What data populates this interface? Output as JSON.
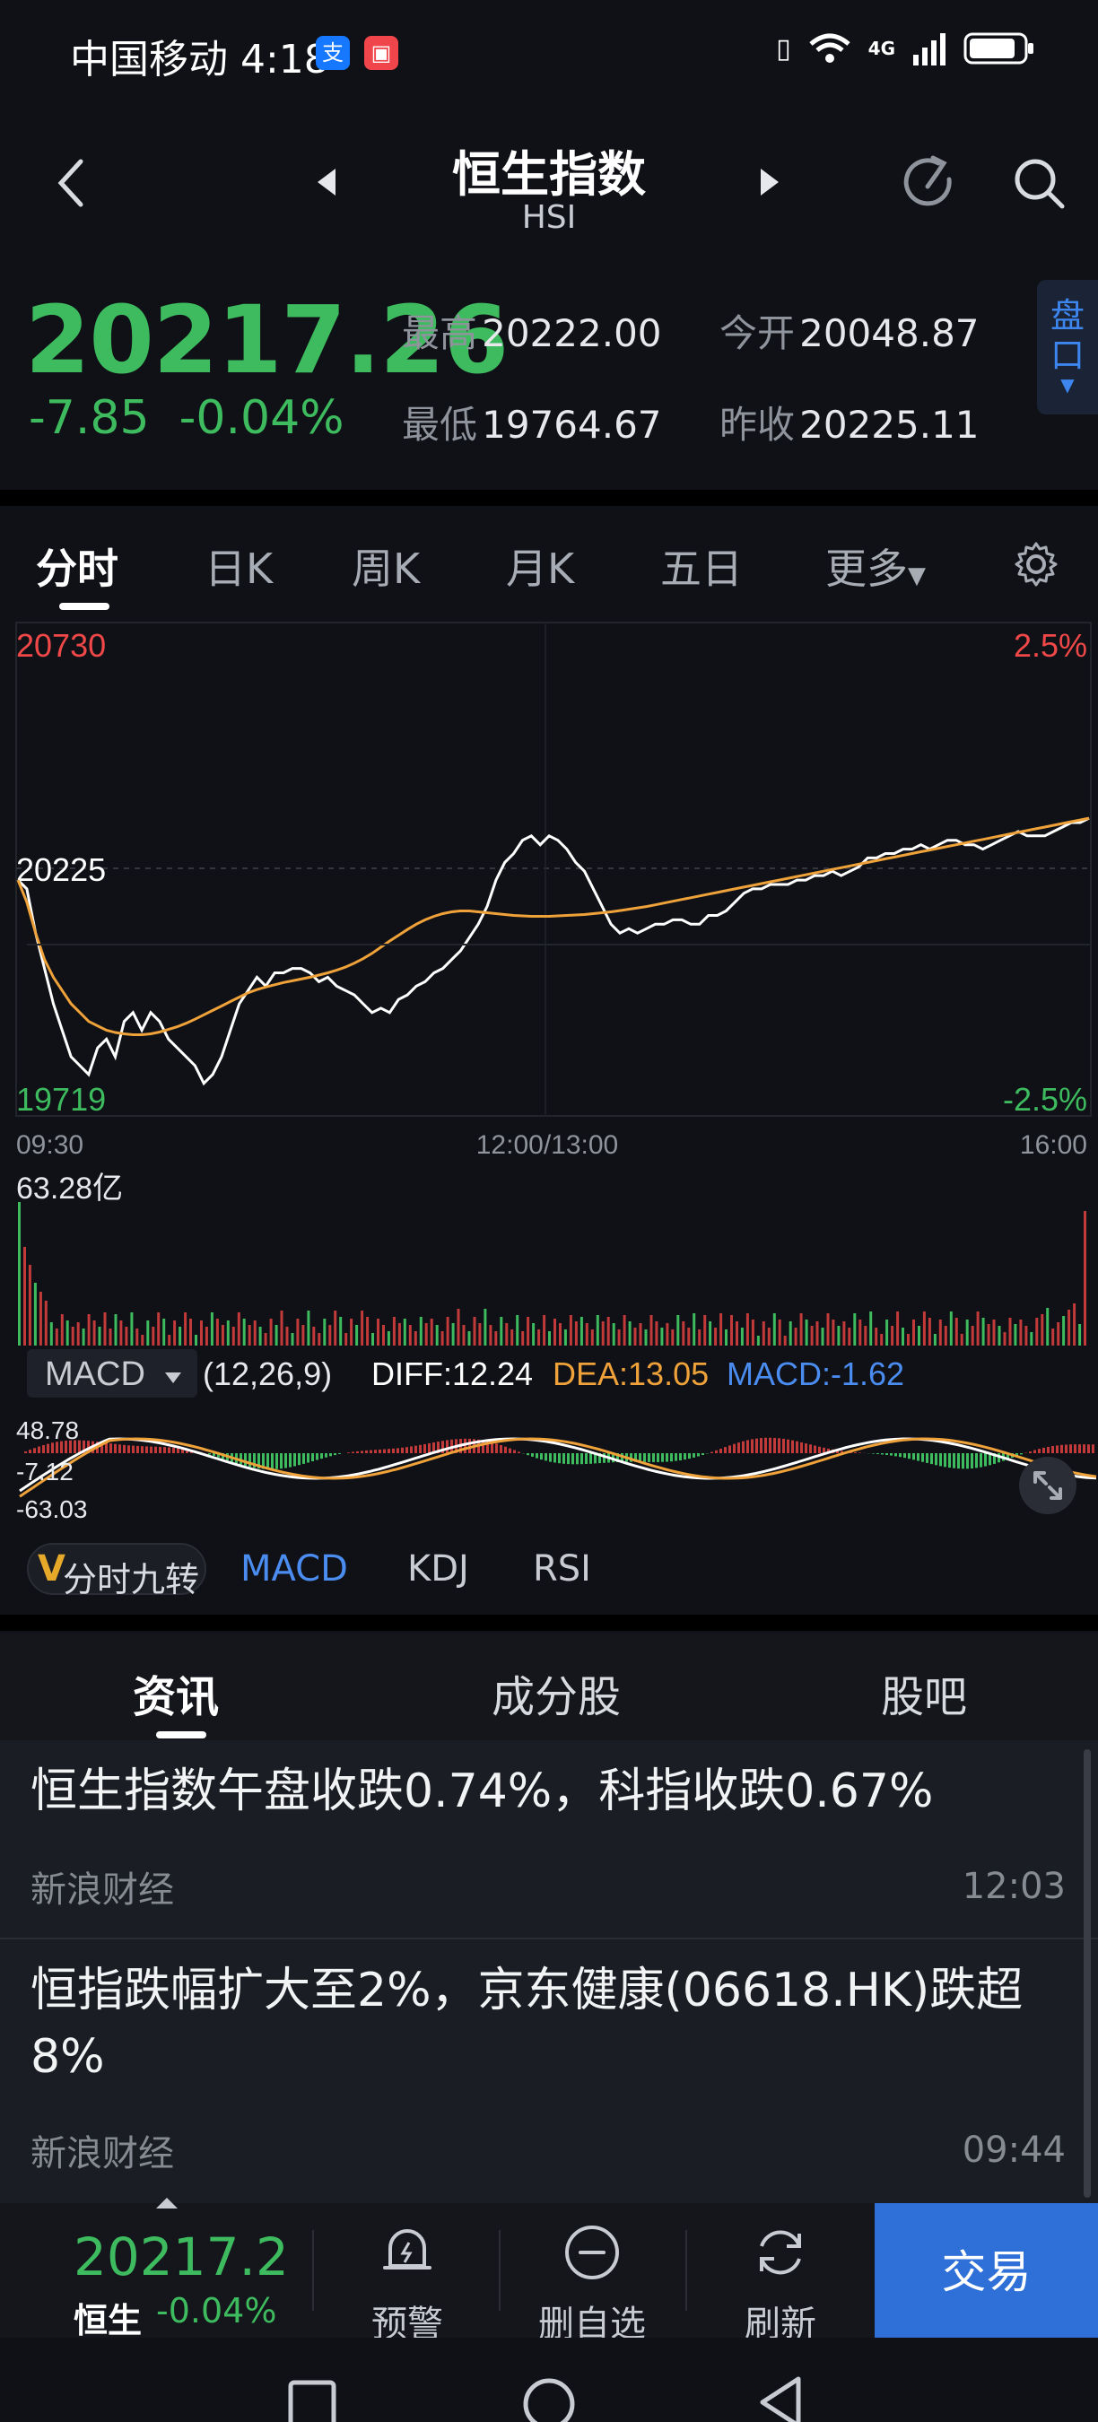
{
  "status_bar": {
    "carrier_time": "中国移动 4:18",
    "network": "4G"
  },
  "header": {
    "title": "恒生指数",
    "subtitle": "HSI"
  },
  "quote": {
    "price": "20217.26",
    "change": "-7.85",
    "change_pct": "-0.04%",
    "high_label": "最高",
    "high": "20222.00",
    "low_label": "最低",
    "low": "19764.67",
    "open_label": "今开",
    "open": "20048.87",
    "prev_close_label": "昨收",
    "prev_close": "20225.11",
    "pankou_label": "盘口"
  },
  "chart_tabs": [
    {
      "label": "分时"
    },
    {
      "label": "日K"
    },
    {
      "label": "周K"
    },
    {
      "label": "月K"
    },
    {
      "label": "五日"
    },
    {
      "label": "更多"
    }
  ],
  "chart_data": {
    "type": "line",
    "y_top_label": "20730",
    "y_mid_label": "20225",
    "y_bottom_label": "19719",
    "pct_top_label": "2.5%",
    "pct_bottom_label": "-2.5%",
    "x_labels": [
      "09:30",
      "12:00/13:00",
      "16:00"
    ],
    "ylim": [
      19719,
      20730
    ],
    "prev_close": 20225,
    "series": [
      {
        "color": "#ffffff",
        "values": [
          20200,
          20180,
          20080,
          20000,
          19920,
          19860,
          19800,
          19780,
          19760,
          19820,
          19840,
          19800,
          19880,
          19900,
          19860,
          19900,
          19880,
          19840,
          19820,
          19800,
          19780,
          19740,
          19760,
          19800,
          19860,
          19920,
          19950,
          19980,
          19960,
          19990,
          19990,
          20000,
          20000,
          19990,
          19970,
          19980,
          19960,
          19950,
          19940,
          19920,
          19900,
          19910,
          19900,
          19930,
          19940,
          19960,
          19970,
          19990,
          20000,
          20020,
          20040,
          20070,
          20100,
          20140,
          20200,
          20240,
          20260,
          20290,
          20300,
          20280,
          20300,
          20290,
          20270,
          20240,
          20220,
          20180,
          20140,
          20100,
          20080,
          20090,
          20080,
          20090,
          20100,
          20100,
          20110,
          20110,
          20100,
          20100,
          20120,
          20120,
          20130,
          20150,
          20170,
          20180,
          20180,
          20190,
          20190,
          20190,
          20200,
          20200,
          20210,
          20210,
          20220,
          20210,
          20220,
          20230,
          20250,
          20250,
          20260,
          20260,
          20270,
          20270,
          20280,
          20270,
          20280,
          20290,
          20290,
          20280,
          20280,
          20270,
          20280,
          20290,
          20300,
          20310,
          20300,
          20300,
          20300,
          20310,
          20320,
          20330,
          20330,
          20340
        ]
      },
      {
        "color": "#f0a23a",
        "values": [
          20200,
          20150,
          20080,
          20020,
          19980,
          19950,
          19920,
          19900,
          19880,
          19870,
          19860,
          19855,
          19852,
          19850,
          19850,
          19852,
          19856,
          19862,
          19868,
          19876,
          19885,
          19895,
          19905,
          19915,
          19925,
          19935,
          19945,
          19952,
          19958,
          19963,
          19968,
          19972,
          19976,
          19980,
          19985,
          19990,
          19996,
          20003,
          20012,
          20022,
          20034,
          20048,
          20062,
          20075,
          20088,
          20100,
          20110,
          20118,
          20124,
          20128,
          20130,
          20130,
          20128,
          20126,
          20124,
          20122,
          20120,
          20119,
          20118,
          20118,
          20118,
          20119,
          20120,
          20121,
          20122,
          20124,
          20126,
          20128,
          20131,
          20134,
          20137,
          20140,
          20144,
          20148,
          20152,
          20156,
          20160,
          20164,
          20168,
          20172,
          20176,
          20180,
          20184,
          20188,
          20192,
          20196,
          20200,
          20204,
          20208,
          20212,
          20216,
          20220,
          20224,
          20228,
          20232,
          20236,
          20240,
          20244,
          20248,
          20252,
          20256,
          20260,
          20264,
          20268,
          20272,
          20276,
          20280,
          20284,
          20288,
          20292,
          20296,
          20300,
          20304,
          20308,
          20312,
          20316,
          20320,
          20324,
          20328,
          20332,
          20336,
          20340
        ]
      }
    ],
    "volume_label": "63.28亿",
    "macd_label": "MACD",
    "macd_params": "(12,26,9)",
    "diff": "DIFF:12.24",
    "dea": "DEA:13.05",
    "macd_value": "MACD:-1.62",
    "macd_axis": [
      "48.78",
      "-7.12",
      "-63.03"
    ]
  },
  "indicator_tabs": {
    "nine_turn": "分时九转",
    "macd": "MACD",
    "kdj": "KDJ",
    "rsi": "RSI"
  },
  "news_tabs": [
    {
      "label": "资讯"
    },
    {
      "label": "成分股"
    },
    {
      "label": "股吧"
    }
  ],
  "news": [
    {
      "title": "恒生指数午盘收跌0.74%，科指收跌0.67%",
      "source": "新浪财经",
      "time": "12:03"
    },
    {
      "title": "恒指跌幅扩大至2%，京东健康(06618.HK)跌超8%",
      "source": "新浪财经",
      "time": "09:44"
    }
  ],
  "bottom_bar": {
    "price": "20217.2",
    "name": "恒生",
    "pct": "-0.04%",
    "alert": "预警",
    "remove_watch": "删自选",
    "refresh": "刷新",
    "trade": "交易"
  }
}
